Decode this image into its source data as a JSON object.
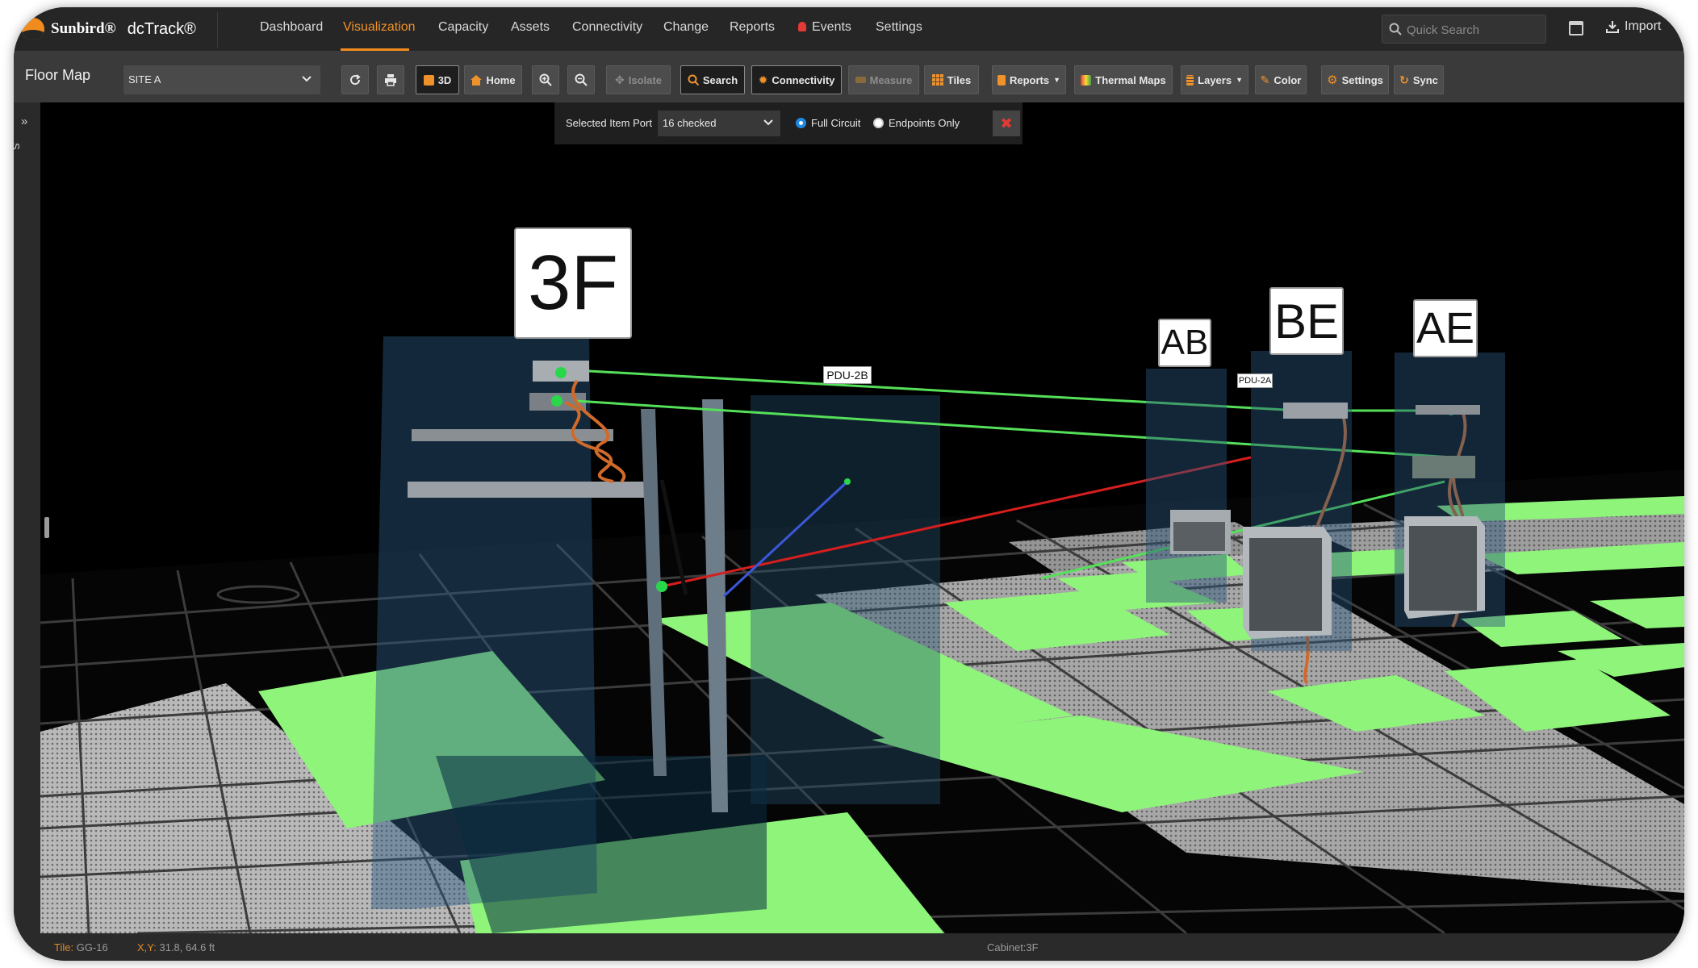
{
  "app": {
    "brand": "Sunbird®",
    "product": "dcTrack®"
  },
  "nav": {
    "items": [
      "Dashboard",
      "Visualization",
      "Capacity",
      "Assets",
      "Connectivity",
      "Change",
      "Reports",
      "Events",
      "Settings"
    ],
    "active": "Visualization"
  },
  "search": {
    "placeholder": "Quick Search"
  },
  "import_label": "Import",
  "toolbar": {
    "title": "Floor Map",
    "site": "SITE A",
    "btn_3d": "3D",
    "home": "Home",
    "isolate": "Isolate",
    "search": "Search",
    "connectivity": "Connectivity",
    "measure": "Measure",
    "tiles": "Tiles",
    "reports": "Reports",
    "thermal": "Thermal Maps",
    "layers": "Layers",
    "color": "Color",
    "settings": "Settings",
    "sync": "Sync"
  },
  "connectivity_panel": {
    "label": "Selected Item Port",
    "port_value": "16 checked",
    "full_circuit": "Full Circuit",
    "endpoints_only": "Endpoints Only",
    "mode": "Full Circuit"
  },
  "scene": {
    "cabinet_labels": [
      "3F",
      "AB",
      "BE",
      "AE"
    ],
    "pdu_labels": [
      "PDU-2B",
      "PDU-2A"
    ],
    "colors": {
      "tile_green": "#8ef57a",
      "link_green": "#55e05a",
      "cable_orange": "#d06a2a",
      "floor_grid": "#3c3c3c"
    }
  },
  "rail": {
    "text": "S..."
  },
  "status": {
    "tile_label": "Tile:",
    "tile_value": "GG-16",
    "xy_label": "X,Y:",
    "xy_value": "31.8, 64.6 ft",
    "cabinet": "Cabinet:3F"
  }
}
